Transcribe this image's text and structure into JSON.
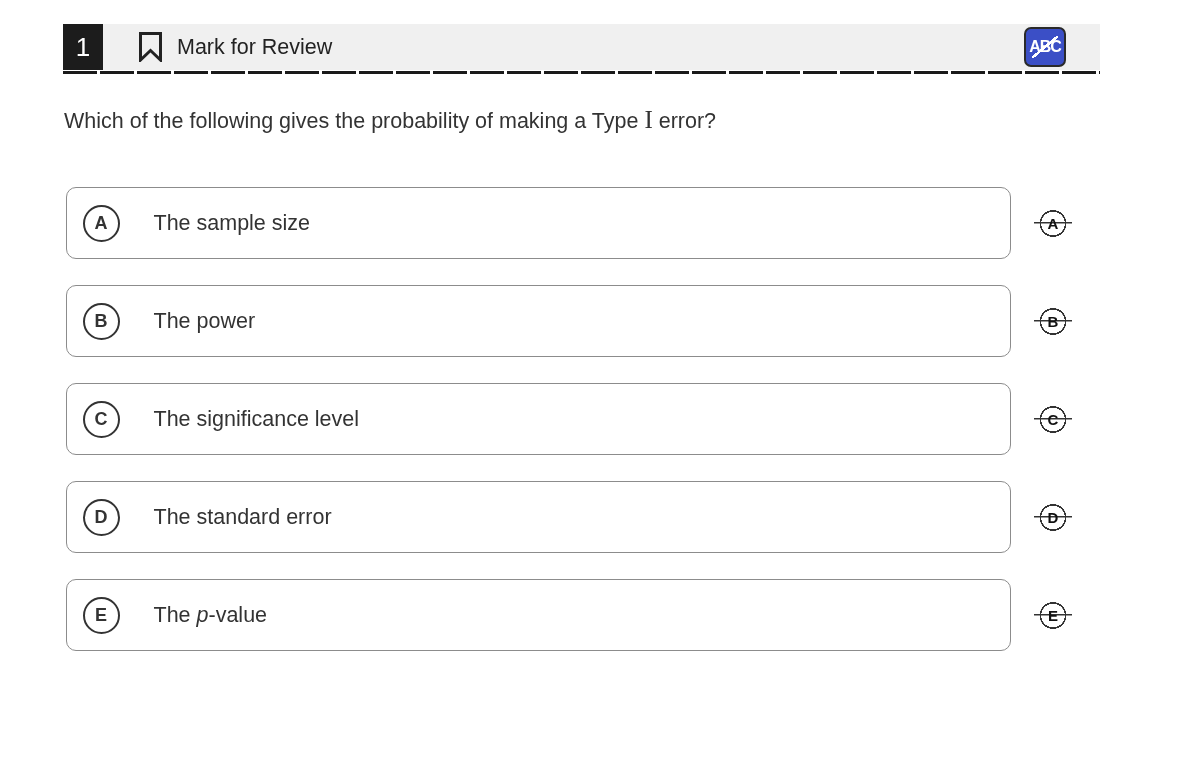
{
  "header": {
    "question_number": "1",
    "mark_for_review": {
      "label": "Mark for Review",
      "marked": false
    },
    "cross_out_tool": {
      "label": "ABC",
      "on": true
    }
  },
  "question": {
    "segments": [
      {
        "kind": "text",
        "text": "Which of the following gives the probability of making a Type "
      },
      {
        "kind": "math",
        "text": "I"
      },
      {
        "kind": "text",
        "text": " error?"
      }
    ]
  },
  "options": [
    {
      "letter": "A",
      "text": "The sample size",
      "selected": false,
      "crossed_out": false,
      "eliminate_letter": "A"
    },
    {
      "letter": "B",
      "text": "The power",
      "selected": false,
      "crossed_out": false,
      "eliminate_letter": "B"
    },
    {
      "letter": "C",
      "text": "The significance level",
      "selected": false,
      "crossed_out": false,
      "eliminate_letter": "C"
    },
    {
      "letter": "D",
      "text": "The standard error",
      "selected": false,
      "crossed_out": false,
      "eliminate_letter": "D"
    },
    {
      "letter": "E",
      "text": "The *p*-value",
      "selected": false,
      "crossed_out": false,
      "eliminate_letter": "E"
    }
  ]
}
